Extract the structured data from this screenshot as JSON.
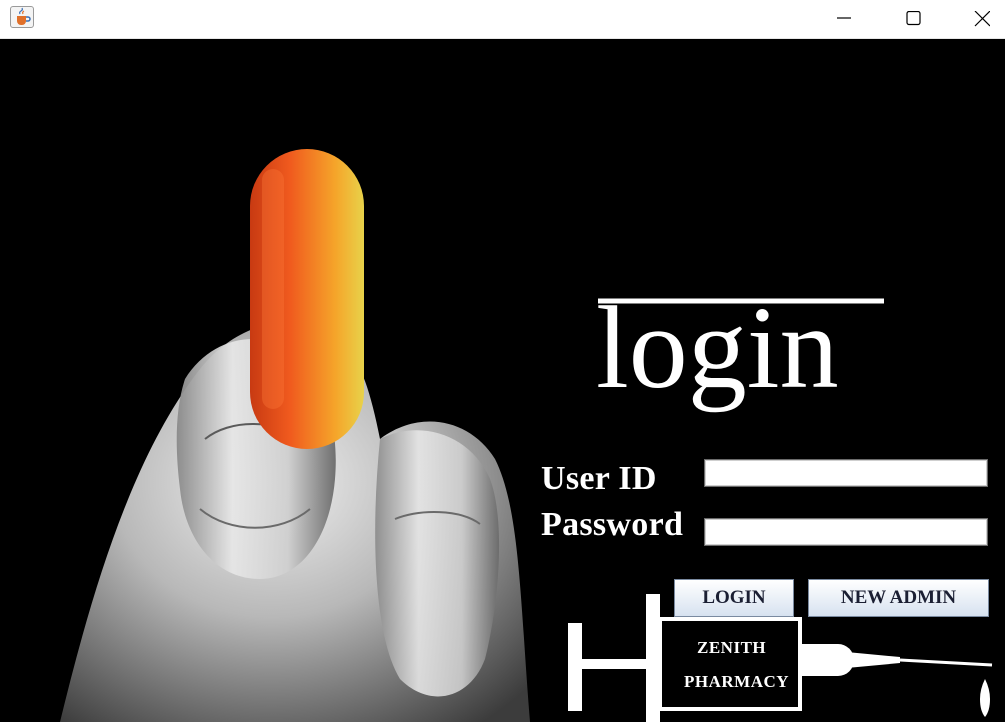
{
  "window": {
    "icon": "java-cup-icon",
    "controls": [
      "minimize-icon",
      "maximize-icon",
      "close-icon"
    ]
  },
  "login": {
    "heading": "login",
    "user_label": "User ID",
    "user_value": "",
    "password_label": "Password",
    "password_value": "",
    "login_button": "LOGIN",
    "new_admin_button": "NEW ADMIN"
  },
  "logo": {
    "line1": "ZENITH",
    "line2": "PHARMACY"
  },
  "colors": {
    "background": "#000000",
    "pill_orange": "#e8561e",
    "pill_yellow": "#f2b51f",
    "text": "#ffffff"
  }
}
